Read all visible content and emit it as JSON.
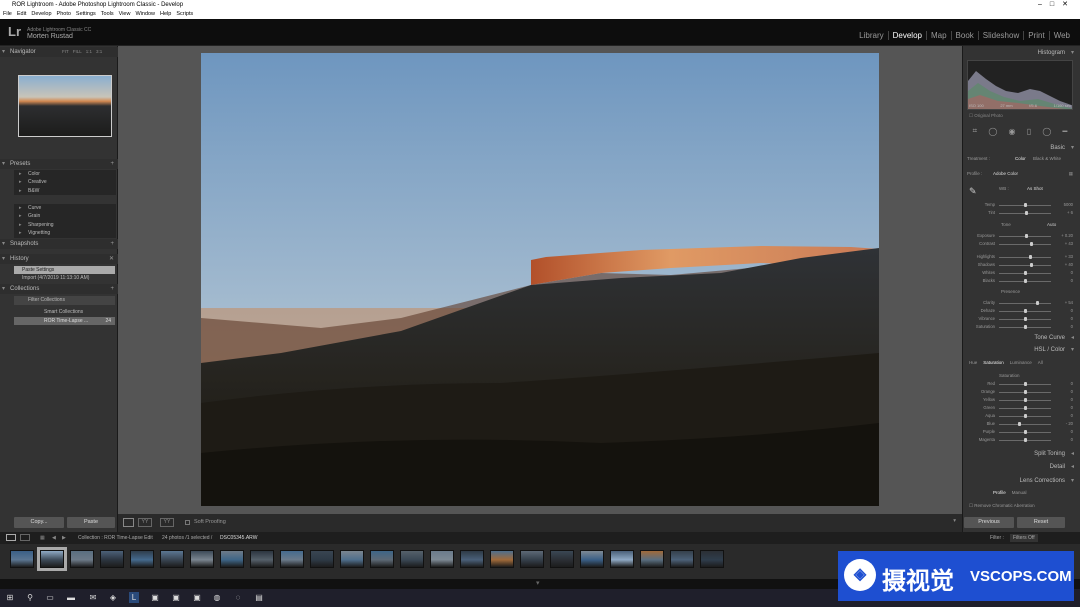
{
  "window": {
    "title": "ROR Lightroom - Adobe Photoshop Lightroom Classic - Develop"
  },
  "menu": [
    "File",
    "Edit",
    "Develop",
    "Photo",
    "Settings",
    "Tools",
    "View",
    "Window",
    "Help",
    "Scripts"
  ],
  "identity": {
    "logo": "Lr",
    "product": "Adobe Lightroom Classic CC",
    "user": "Morten Rustad"
  },
  "modules": [
    {
      "label": "Library"
    },
    {
      "label": "Develop",
      "active": true
    },
    {
      "label": "Map"
    },
    {
      "label": "Book"
    },
    {
      "label": "Slideshow"
    },
    {
      "label": "Print"
    },
    {
      "label": "Web"
    }
  ],
  "left": {
    "navigator": {
      "title": "Navigator",
      "modes": [
        "FIT",
        "FILL",
        "1:1",
        "3:1"
      ]
    },
    "presets": {
      "title": "Presets",
      "group1": [
        "Color",
        "Creative",
        "B&W"
      ],
      "group2": [
        "Curve",
        "Grain",
        "Sharpening",
        "Vignetting"
      ]
    },
    "snapshots": {
      "title": "Snapshots"
    },
    "history": {
      "title": "History",
      "items": [
        "Paste Settings",
        "Import (4/7/2019 11:13:10 AM)"
      ]
    },
    "collections": {
      "title": "Collections",
      "filter": "Filter Collections",
      "items": [
        {
          "label": "Smart Collections",
          "count": ""
        },
        {
          "label": "ROR Time-Lapse ...",
          "count": "24"
        }
      ]
    },
    "copy": "Copy...",
    "paste": "Paste"
  },
  "toolbar": {
    "soft_proofing": "Soft Proofing"
  },
  "right": {
    "histogram": {
      "title": "Histogram",
      "info": [
        "ISO 100",
        "27 mm",
        "f/5.6",
        "1/160 sec"
      ],
      "original": "Original Photo"
    },
    "basic": {
      "title": "Basic",
      "treatment_label": "Treatment :",
      "treatment": [
        "Color",
        "Black & White"
      ],
      "profile_label": "Profile :",
      "profile": "Adobe Color",
      "wb_label": "WB :",
      "wb": "As Shot",
      "tone_label": "Tone",
      "auto": "Auto",
      "presence_label": "Presence",
      "sliders": [
        {
          "label": "Temp",
          "value": "5000",
          "pos": 0.5
        },
        {
          "label": "Tint",
          "value": "+ 6",
          "pos": 0.52
        },
        {
          "label": "Exposure",
          "value": "+ 0.20",
          "pos": 0.53
        },
        {
          "label": "Contrast",
          "value": "+ 43",
          "pos": 0.62
        },
        {
          "label": "Highlights",
          "value": "+ 33",
          "pos": 0.6
        },
        {
          "label": "Shadows",
          "value": "+ 40",
          "pos": 0.63
        },
        {
          "label": "Whites",
          "value": "0",
          "pos": 0.5
        },
        {
          "label": "Blacks",
          "value": "0",
          "pos": 0.5
        },
        {
          "label": "Clarity",
          "value": "+ 54",
          "pos": 0.74
        },
        {
          "label": "Dehaze",
          "value": "0",
          "pos": 0.5
        },
        {
          "label": "Vibrance",
          "value": "0",
          "pos": 0.5
        },
        {
          "label": "Saturation",
          "value": "0",
          "pos": 0.5
        }
      ]
    },
    "tone_curve": {
      "title": "Tone Curve"
    },
    "hsl": {
      "title": "HSL / Color",
      "tabs": [
        "Hue",
        "Saturation",
        "Luminance",
        "All"
      ],
      "section": "Saturation",
      "sliders": [
        {
          "label": "Red",
          "value": "0",
          "pos": 0.5
        },
        {
          "label": "Orange",
          "value": "0",
          "pos": 0.5
        },
        {
          "label": "Yellow",
          "value": "0",
          "pos": 0.5
        },
        {
          "label": "Green",
          "value": "0",
          "pos": 0.5
        },
        {
          "label": "Aqua",
          "value": "0",
          "pos": 0.5
        },
        {
          "label": "Blue",
          "value": "- 20",
          "pos": 0.4
        },
        {
          "label": "Purple",
          "value": "0",
          "pos": 0.5
        },
        {
          "label": "Magenta",
          "value": "0",
          "pos": 0.5
        }
      ]
    },
    "split_toning": {
      "title": "Split Toning"
    },
    "detail": {
      "title": "Detail"
    },
    "lens": {
      "title": "Lens Corrections",
      "tabs": [
        "Profile",
        "Manual"
      ],
      "option": "Remove Chromatic Aberration"
    },
    "previous": "Previous",
    "reset": "Reset"
  },
  "filmbar": {
    "source": "Collection : ROR Time-Lapse Edit",
    "count": "24 photos /1 selected /",
    "file": "DSC05345.ARW",
    "filter_label": "Filter :",
    "filter_value": "Filters Off"
  },
  "filmstrip": {
    "thumb_count": 24,
    "selected_index": 1
  },
  "watermark": {
    "cn": "摄视觉",
    "url": "VSCOPS.COM"
  },
  "colors": {
    "panel": "#333333",
    "workspace": "#555555",
    "active_text": "#ffffff",
    "watermark_bg": "#1e4fd1"
  }
}
